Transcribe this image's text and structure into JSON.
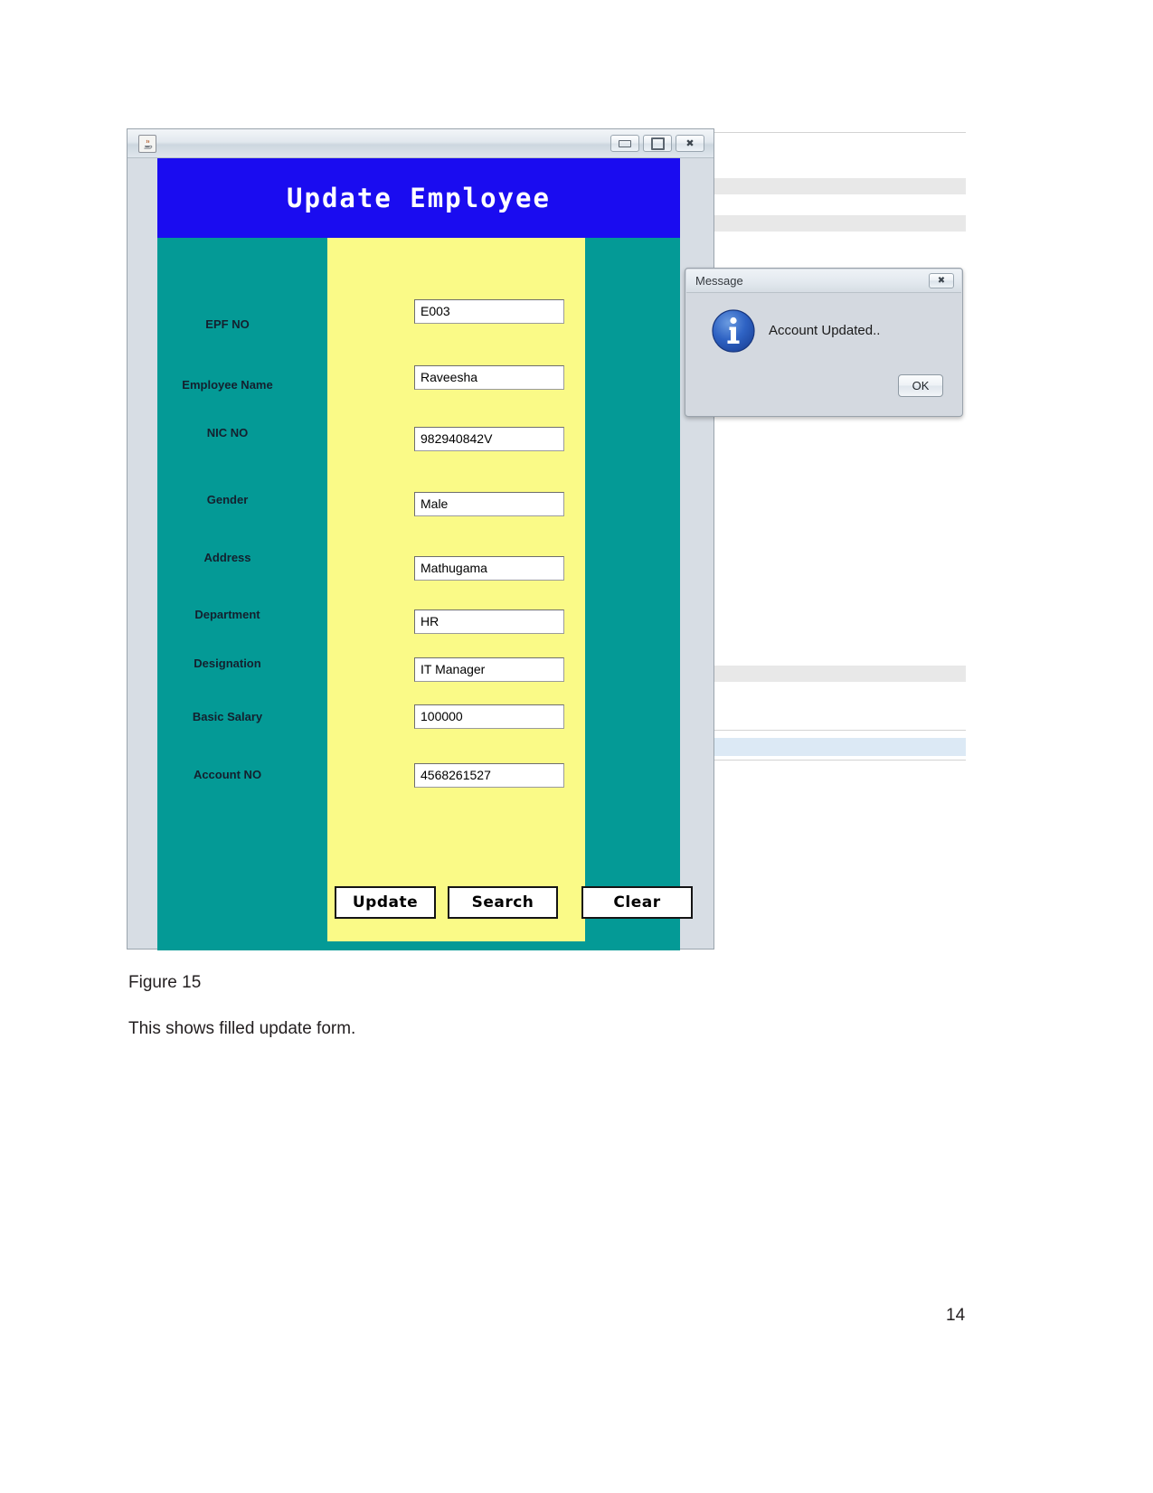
{
  "window": {
    "app_icon": "java-coffee-cup-icon",
    "controls": {
      "minimize": "–",
      "maximize": "□",
      "close": "✖"
    }
  },
  "form": {
    "title": "Update Employee",
    "header_color": "#1a0cf0",
    "sidebar_color": "#049a96",
    "panel_color": "#fafa87",
    "fields": [
      {
        "label": "EPF NO",
        "value": "E003",
        "name": "epf-no"
      },
      {
        "label": "Employee Name",
        "value": "Raveesha",
        "name": "employee-name"
      },
      {
        "label": "NIC NO",
        "value": "982940842V",
        "name": "nic-no"
      },
      {
        "label": "Gender",
        "value": "Male",
        "name": "gender"
      },
      {
        "label": "Address",
        "value": "Mathugama",
        "name": "address"
      },
      {
        "label": "Department",
        "value": "HR",
        "name": "department"
      },
      {
        "label": "Designation",
        "value": "IT Manager",
        "name": "designation"
      },
      {
        "label": "Basic Salary",
        "value": "100000",
        "name": "basic-salary"
      },
      {
        "label": "Account NO",
        "value": "4568261527",
        "name": "account-no"
      }
    ],
    "buttons": {
      "update": "Update",
      "search": "Search",
      "clear": "Clear"
    }
  },
  "dialog": {
    "title": "Message",
    "close_glyph": "✖",
    "icon": "info-icon",
    "message": "Account Updated..",
    "ok_label": "OK"
  },
  "caption": {
    "figure": "Figure 15",
    "description": "This shows filled update form."
  },
  "footer": {
    "page_number": "14"
  }
}
